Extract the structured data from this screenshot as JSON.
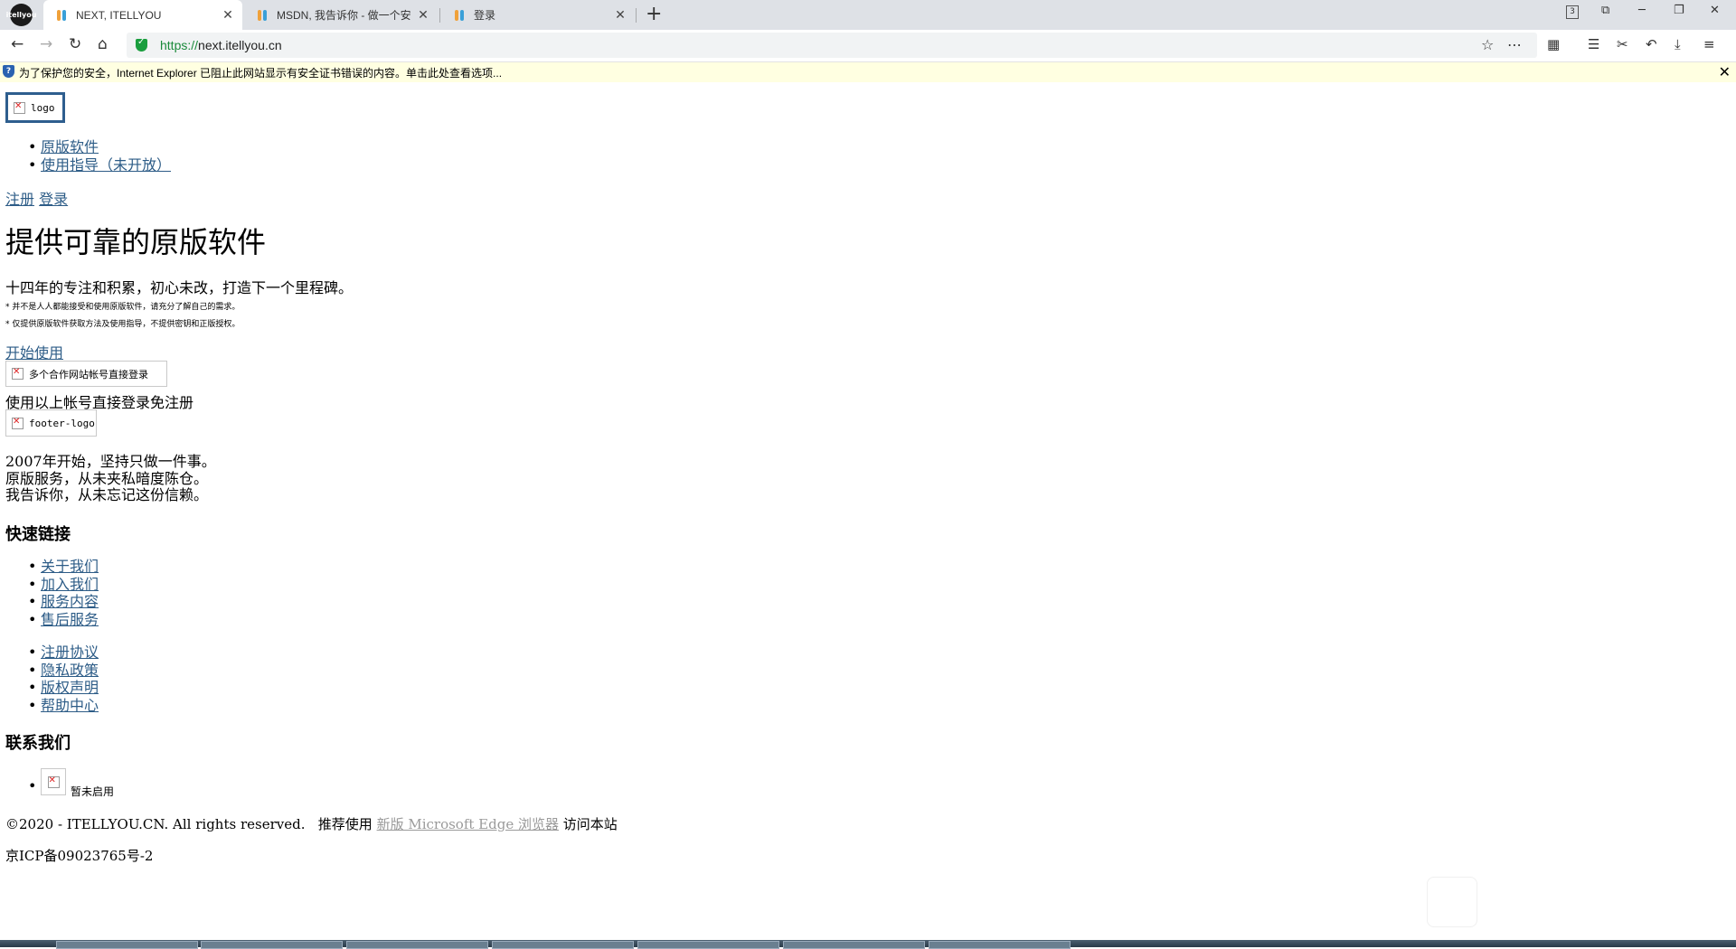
{
  "browser": {
    "profile_label": "itellyou",
    "tabs": [
      {
        "title": "NEXT, ITELLYOU",
        "close": "✕"
      },
      {
        "title": "MSDN, 我告诉你 - 做一个安",
        "close": "✕"
      },
      {
        "title": "登录",
        "close": "✕"
      }
    ],
    "new_tab": "+",
    "tab_count": "3",
    "url_scheme": "https://",
    "url_host": "next.itellyou.cn"
  },
  "infobar": {
    "message": "为了保护您的安全，Internet Explorer 已阻止此网站显示有安全证书错误的内容。单击此处查看选项...",
    "close": "✕"
  },
  "page": {
    "logo_alt": "logo",
    "nav": [
      "原版软件",
      "使用指导（未开放）"
    ],
    "register": "注册",
    "login": "登录",
    "headline": "提供可靠的原版软件",
    "subtitle": "十四年的专注和积累，初心未改，打造下一个里程碑。",
    "notes": [
      "* 并不是人人都能接受和使用原版软件，请充分了解自己的需求。",
      "* 仅提供原版软件获取方法及使用指导，不提供密钥和正版授权。"
    ],
    "start": "开始使用",
    "partner_img_alt": "多个合作网站帐号直接登录",
    "partner_text": "使用以上帐号直接登录免注册",
    "footer_logo_alt": "footer-logo",
    "story": [
      "2007年开始，坚持只做一件事。",
      "原版服务，从未夹私暗度陈仓。",
      "我告诉你，从未忘记这份信赖。"
    ],
    "quick_links_title": "快速链接",
    "quick_links_1": [
      "关于我们",
      "加入我们",
      "服务内容",
      "售后服务"
    ],
    "quick_links_2": [
      "注册协议",
      "隐私政策",
      "版权声明",
      "帮助中心"
    ],
    "contact_title": "联系我们",
    "contact_item": "暂未启用",
    "copyright": "©2020 - ITELLYOU.CN. All rights reserved.",
    "recommend_prefix": "推荐使用",
    "recommend_link": "新版 Microsoft Edge 浏览器",
    "recommend_suffix": "访问本站",
    "icp": "京ICP备09023765号-2"
  }
}
